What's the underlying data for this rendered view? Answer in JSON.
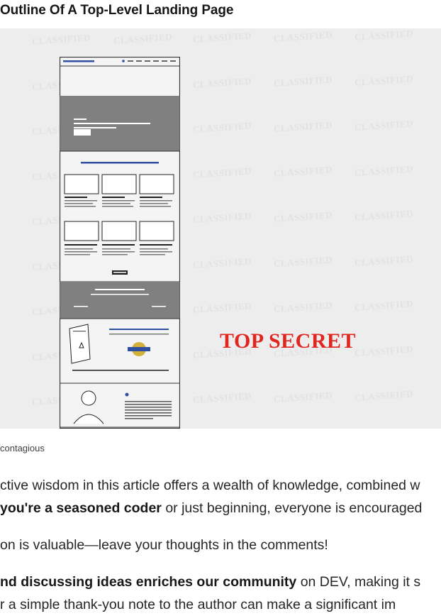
{
  "article": {
    "heading": "Outline Of A Top-Level Landing Page",
    "figure": {
      "watermark": "CLASSIFIED",
      "stamp": "TOP SECRET",
      "stamp_color": "#e0261f",
      "caption": "contagious"
    },
    "paragraphs": [
      {
        "lines": [
          {
            "text": "ctive wisdom in this article offers a wealth of knowledge, combined w"
          },
          {
            "strong": "you're a seasoned coder",
            "text": " or just beginning, everyone is encouraged"
          }
        ]
      },
      {
        "lines": [
          {
            "text": "on is valuable—leave your thoughts in the comments!"
          }
        ]
      },
      {
        "lines": [
          {
            "strong": "nd discussing ideas enriches our community",
            "text": " on DEV, making it s"
          },
          {
            "text": "r a simple thank-you note to the author can make a significant im"
          }
        ]
      }
    ]
  }
}
